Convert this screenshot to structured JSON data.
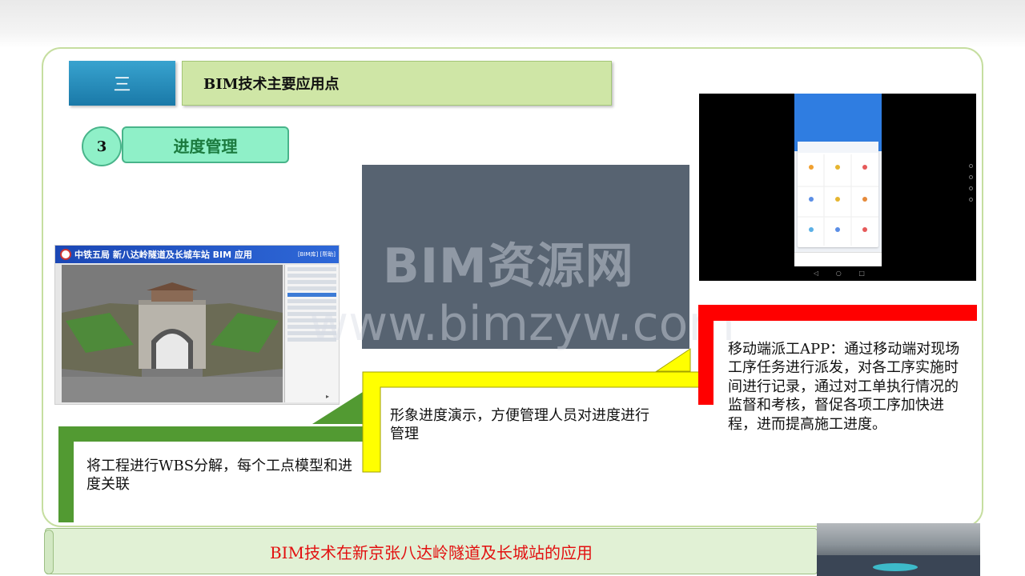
{
  "section": {
    "number": "三",
    "title": "BIM技术主要应用点"
  },
  "subsection": {
    "number": "3",
    "title": "进度管理"
  },
  "bim_app": {
    "header_title": "中铁五局 新八达岭隧道及长城车站 BIM 应用",
    "header_links": "[BIM库]  [帮助]"
  },
  "watermark": {
    "line1": "BIM资源网",
    "line2": "www.bimzyw.com"
  },
  "descriptions": {
    "wbs": "将工程进行WBS分解，每个工点模型和进度关联",
    "demo": "形象进度演示，方便管理人员对进度进行管理",
    "app": "移动端派工APP：通过移动端对现场工序任务进行派发，对各工序实施时间进行记录，通过对工单执行情况的监督和考核，督促各项工序加快进程，进而提高施工进度。"
  },
  "banner": {
    "text": "BIM技术在新京张八达岭隧道及长城站的应用"
  },
  "colors": {
    "green_step": "#529a32",
    "yellow_step": "#ffff00",
    "red_step": "#ff0000",
    "banner_text": "#e21010"
  }
}
